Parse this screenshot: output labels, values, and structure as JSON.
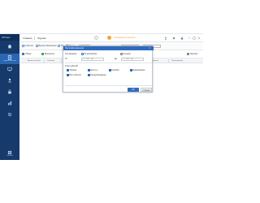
{
  "app": {
    "title": "XProtec"
  },
  "topbar": {
    "tabs": [
      "Главная",
      "Журнал"
    ],
    "badge_label": "Отображение журнала"
  },
  "sidebar": {
    "items": [
      {
        "label": "Главная",
        "icon": "home-icon",
        "active": false
      },
      {
        "label": "Журнал событий",
        "icon": "journal-icon",
        "active": true
      },
      {
        "label": "Устройства",
        "icon": "device-icon",
        "active": false
      },
      {
        "label": "Пользователи",
        "icon": "users-icon",
        "active": false
      },
      {
        "label": "Доступ",
        "icon": "lock-icon",
        "active": false
      },
      {
        "label": "Отчеты",
        "icon": "report-icon",
        "active": false
      },
      {
        "label": "Настройки",
        "icon": "gear-icon",
        "active": false
      }
    ],
    "bottom_label": "Система"
  },
  "filters": {
    "items": [
      "Событие",
      "Время обновления",
      "Тип",
      "Поиск"
    ],
    "select_value": "Все типы",
    "right_items": [
      "",
      ""
    ]
  },
  "toolbar": {
    "buttons": [
      "Обзор",
      "Выгрузить",
      "Свойства",
      "Наблюдение"
    ],
    "right_button": "Экспорт"
  },
  "table": {
    "columns": [
      "Время события",
      "Событие",
      "Тип",
      "Источник",
      "Детали",
      "Операция",
      "Результат",
      "Пользователь"
    ]
  },
  "dialog": {
    "title": "Настройки фильтра",
    "time_label": "Тип времени",
    "time_options": [
      "Ручной выбор",
      "Сегодня"
    ],
    "from_label": "От",
    "to_label": "До",
    "from_placeholder": "ГГ - ММ - ДД",
    "to_placeholder": "ГГ - ММ - ДД",
    "types_label": "Типы событий",
    "checkboxes": [
      "Тревога",
      "Event_1",
      "Ошибка",
      "Информация",
      "Все события",
      "Предупреждение",
      "Статус",
      "Изменение"
    ],
    "ok_label": "ОК",
    "cancel_label": "Отмена"
  },
  "colors": {
    "sidebar_bg": "#163a6b",
    "accent": "#2f6bbd",
    "badge_orange": "#f3a53a"
  }
}
